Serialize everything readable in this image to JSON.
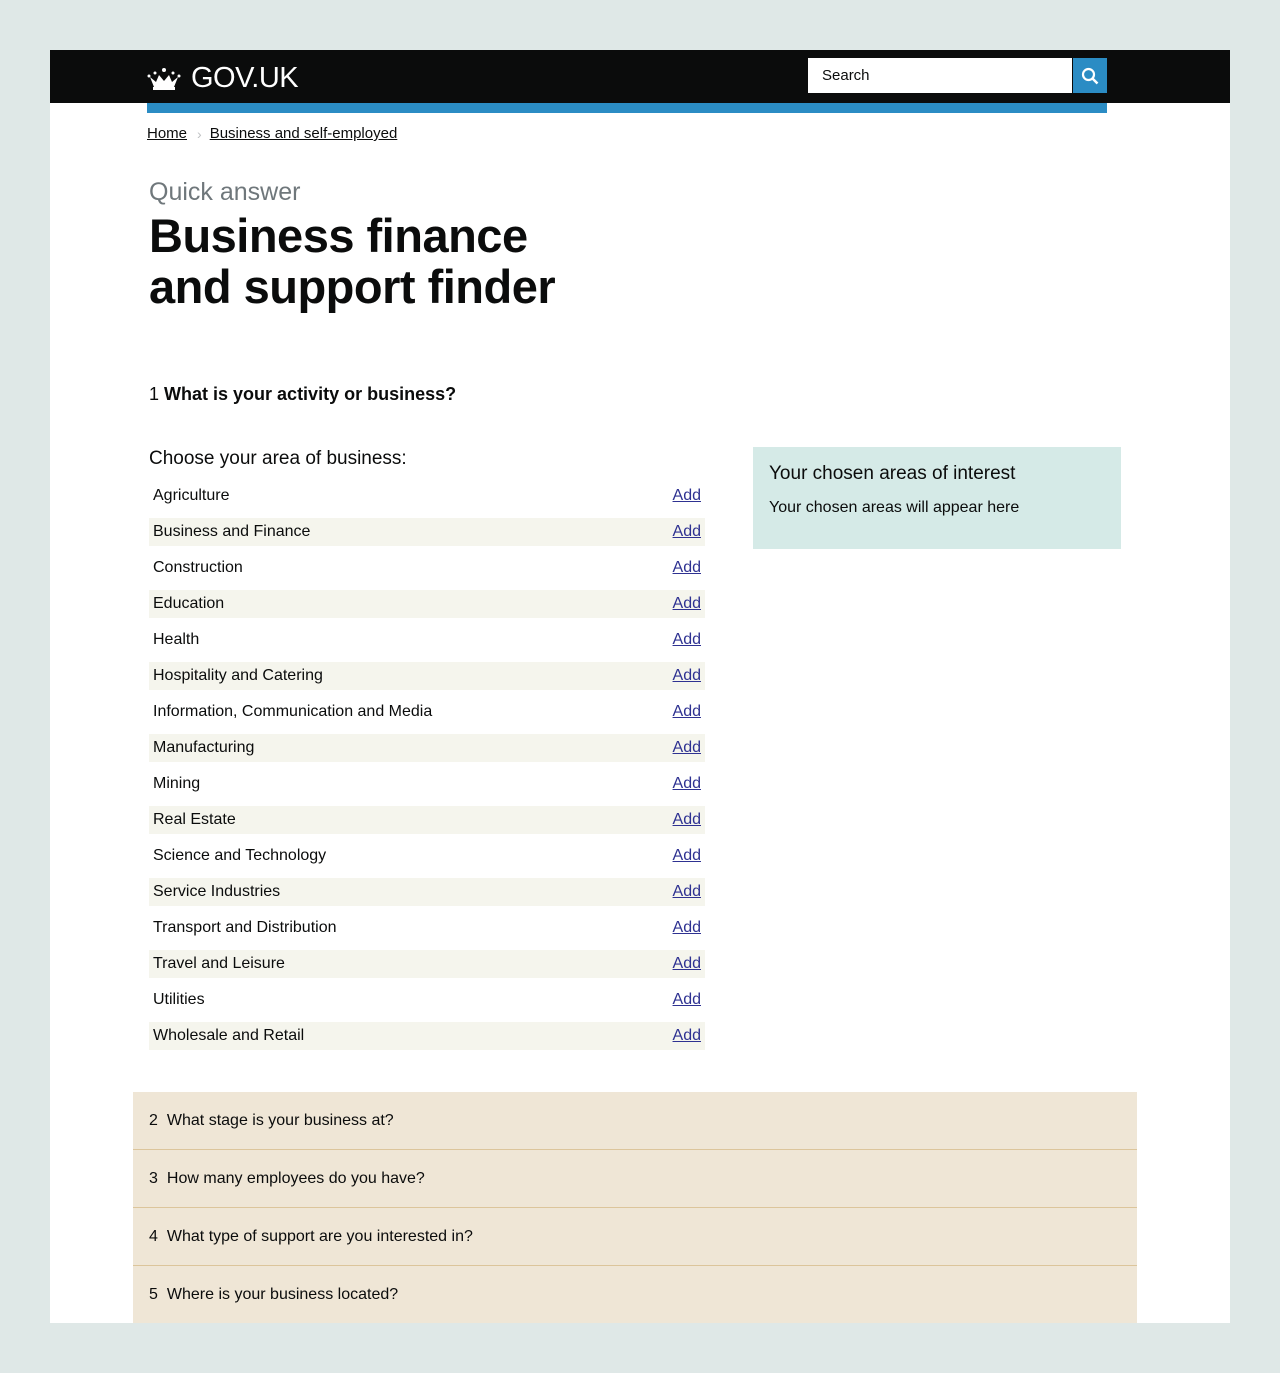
{
  "header": {
    "logo_text": "GOV.UK",
    "search_placeholder": "Search"
  },
  "breadcrumb": [
    {
      "label": "Home"
    },
    {
      "label": "Business and self-employed"
    }
  ],
  "kicker": "Quick answer",
  "title": "Business finance and support finder",
  "question1": {
    "number": "1",
    "text": "What is your activity or business?"
  },
  "choose_label": "Choose your area of business:",
  "add_label": "Add",
  "areas": [
    "Agriculture",
    "Business and Finance",
    "Construction",
    "Education",
    "Health",
    "Hospitality and Catering",
    "Information, Communication and Media",
    "Manufacturing",
    "Mining",
    "Real Estate",
    "Science and Technology",
    "Service Industries",
    "Transport and Distribution",
    "Travel and Leisure",
    "Utilities",
    "Wholesale and Retail"
  ],
  "sidebar": {
    "title": "Your chosen areas of interest",
    "empty_text": "Your chosen areas will appear here"
  },
  "questions": [
    {
      "number": "2",
      "text": "What stage is your business at?"
    },
    {
      "number": "3",
      "text": "How many employees do you have?"
    },
    {
      "number": "4",
      "text": "What type of support are you interested in?"
    },
    {
      "number": "5",
      "text": "Where is your business located?"
    }
  ],
  "colors": {
    "header": "#0b0c0c",
    "accent": "#2b8cc4",
    "link": "#2e3191",
    "sidebar": "#d5eae7",
    "accordion": "#efe6d6"
  }
}
